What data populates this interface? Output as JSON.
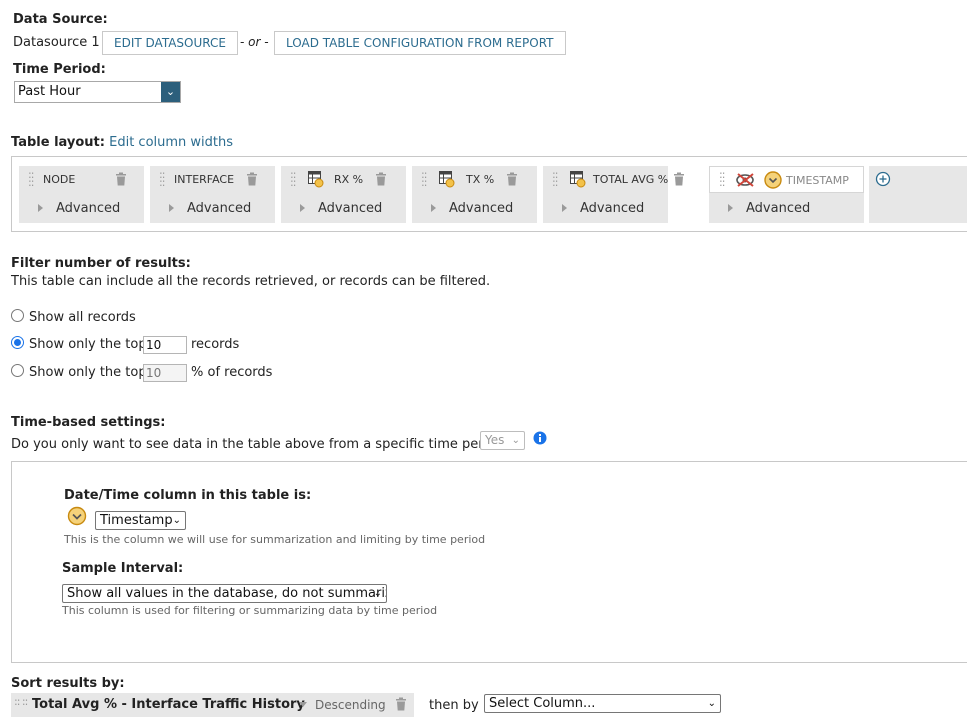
{
  "data_source": {
    "label": "Data Source:",
    "name": "Datasource 1",
    "edit_button": "EDIT DATASOURCE",
    "or_text": "- or -",
    "load_button": "LOAD TABLE CONFIGURATION FROM REPORT"
  },
  "time_period": {
    "label": "Time Period:",
    "value": "Past Hour"
  },
  "table_layout": {
    "label": "Table layout:",
    "edit_link": "Edit column widths",
    "columns": [
      {
        "name": "NODE",
        "advanced": "Advanced"
      },
      {
        "name": "INTERFACE",
        "advanced": "Advanced"
      },
      {
        "name": "RX %",
        "advanced": "Advanced"
      },
      {
        "name": "TX %",
        "advanced": "Advanced"
      },
      {
        "name": "TOTAL AVG %",
        "advanced": "Advanced"
      },
      {
        "name": "TIMESTAMP",
        "advanced": "Advanced"
      }
    ]
  },
  "filter": {
    "title": "Filter number of results:",
    "description": "This table can include all the records retrieved, or records can be filtered.",
    "option_all": "Show all records",
    "option_top_prefix": "Show only the top",
    "option_top_value": "10",
    "option_top_suffix": "records",
    "option_pct_prefix": "Show only the top",
    "option_pct_value": "10",
    "option_pct_suffix": "% of records",
    "selected": "top"
  },
  "time_based": {
    "title": "Time-based settings:",
    "question": "Do you only want to see data in the table above from a specific time period?",
    "answer": "Yes",
    "datetime_label": "Date/Time column in this table is:",
    "datetime_value": "Timestamp",
    "datetime_help": "This is the column we will use for summarization and limiting by time period",
    "sample_label": "Sample Interval:",
    "sample_value": "Show all values in the database, do not summarize",
    "sample_help": "This column is used for filtering or summarizing data by time period"
  },
  "sort": {
    "title": "Sort results by:",
    "column": "Total Avg % - Interface Traffic History",
    "direction": "Descending",
    "then_by": "then by",
    "then_select": "Select Column..."
  },
  "colors": {
    "accent": "#2c6c8f",
    "select_arrow": "#2c5f7c",
    "radio_selected": "#1a73e8",
    "card_bg": "#e7e7e7"
  }
}
